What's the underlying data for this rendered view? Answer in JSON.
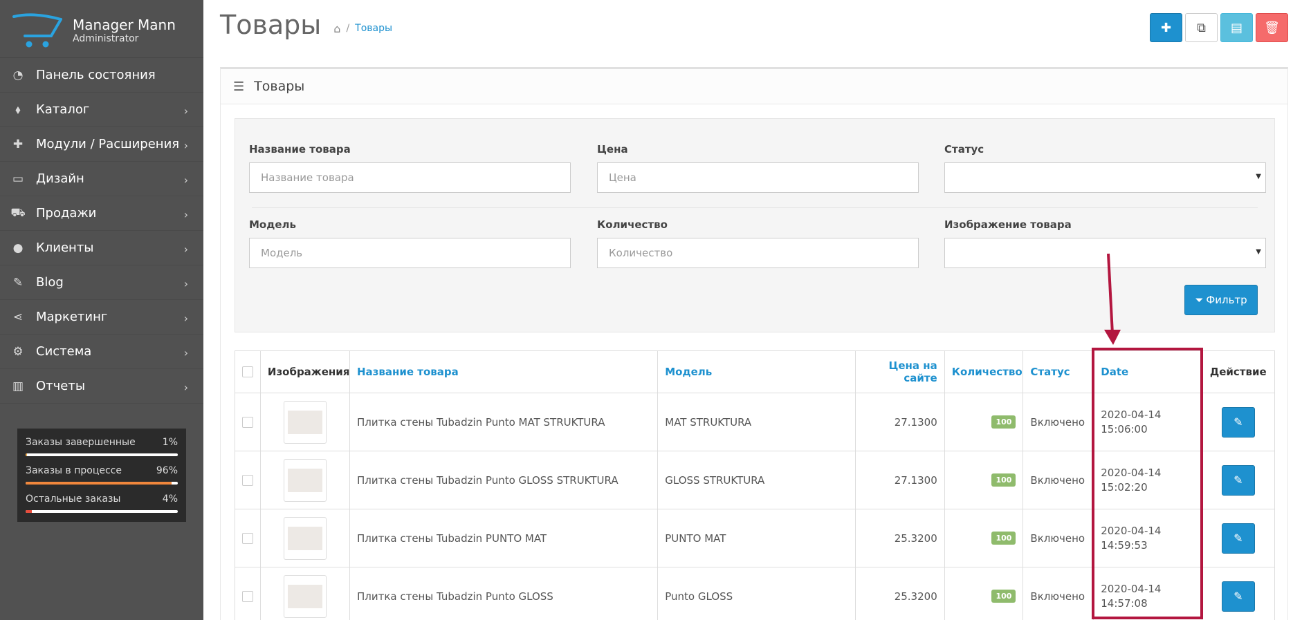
{
  "brand": {
    "name": "Manager Mann",
    "role": "Administrator"
  },
  "menu": [
    {
      "label": "Панель состояния",
      "icon": "dashboard-icon",
      "glyph": "◔",
      "chevron": false
    },
    {
      "label": "Каталог",
      "icon": "tags-icon",
      "glyph": "⬧",
      "chevron": true
    },
    {
      "label": "Модули / Расширения",
      "icon": "puzzle-icon",
      "glyph": "✚",
      "chevron": true
    },
    {
      "label": "Дизайн",
      "icon": "desktop-icon",
      "glyph": "▭",
      "chevron": true
    },
    {
      "label": "Продажи",
      "icon": "cart-icon",
      "glyph": "⛟",
      "chevron": true
    },
    {
      "label": "Клиенты",
      "icon": "user-icon",
      "glyph": "●",
      "chevron": true
    },
    {
      "label": "Blog",
      "icon": "edit-icon",
      "glyph": "✎",
      "chevron": true
    },
    {
      "label": "Маркетинг",
      "icon": "share-icon",
      "glyph": "⋖",
      "chevron": true
    },
    {
      "label": "Система",
      "icon": "cog-icon",
      "glyph": "⚙",
      "chevron": true
    },
    {
      "label": "Отчеты",
      "icon": "bar-chart-icon",
      "glyph": "▥",
      "chevron": true
    }
  ],
  "stats": [
    {
      "label": "Заказы завершенные",
      "value": "1%",
      "fraction": 0.01,
      "color": "#f0ad4e"
    },
    {
      "label": "Заказы в процессе",
      "value": "96%",
      "fraction": 0.96,
      "color": "#f0873c"
    },
    {
      "label": "Остальные заказы",
      "value": "4%",
      "fraction": 0.04,
      "color": "#e74c3c"
    }
  ],
  "header": {
    "title": "Товары",
    "breadcrumb": "Товары"
  },
  "panel": {
    "title": "Товары"
  },
  "filter": {
    "name_label": "Название товара",
    "name_placeholder": "Название товара",
    "price_label": "Цена",
    "price_placeholder": "Цена",
    "status_label": "Статус",
    "model_label": "Модель",
    "model_placeholder": "Модель",
    "qty_label": "Количество",
    "qty_placeholder": "Количество",
    "image_label": "Изображение товара",
    "button": "Фильтр"
  },
  "table": {
    "headers": {
      "image": "Изображения",
      "name": "Название товара",
      "model": "Модель",
      "price": "Цена на сайте",
      "qty": "Количество",
      "status": "Статус",
      "date": "Date",
      "action": "Действие"
    },
    "rows": [
      {
        "name": "Плитка стены Tubadzin Punto MAT STRUKTURA",
        "model": "MAT STRUKTURA",
        "price": "27.1300",
        "qty": "100",
        "status": "Включено",
        "date": "2020-04-14",
        "time": "15:06:00"
      },
      {
        "name": "Плитка стены Tubadzin Punto GLOSS STRUKTURA",
        "model": "GLOSS STRUKTURA",
        "price": "27.1300",
        "qty": "100",
        "status": "Включено",
        "date": "2020-04-14",
        "time": "15:02:20"
      },
      {
        "name": "Плитка стены Tubadzin PUNTO MAT",
        "model": "PUNTO MAT",
        "price": "25.3200",
        "qty": "100",
        "status": "Включено",
        "date": "2020-04-14",
        "time": "14:59:53"
      },
      {
        "name": "Плитка стены Tubadzin Punto GLOSS",
        "model": "Punto GLOSS",
        "price": "25.3200",
        "qty": "100",
        "status": "Включено",
        "date": "2020-04-14",
        "time": "14:57:08"
      }
    ]
  },
  "colors": {
    "accent": "#1e91cf",
    "sidebar": "#515151",
    "annotation": "#b3163f",
    "badge": "#8fbb6c"
  }
}
